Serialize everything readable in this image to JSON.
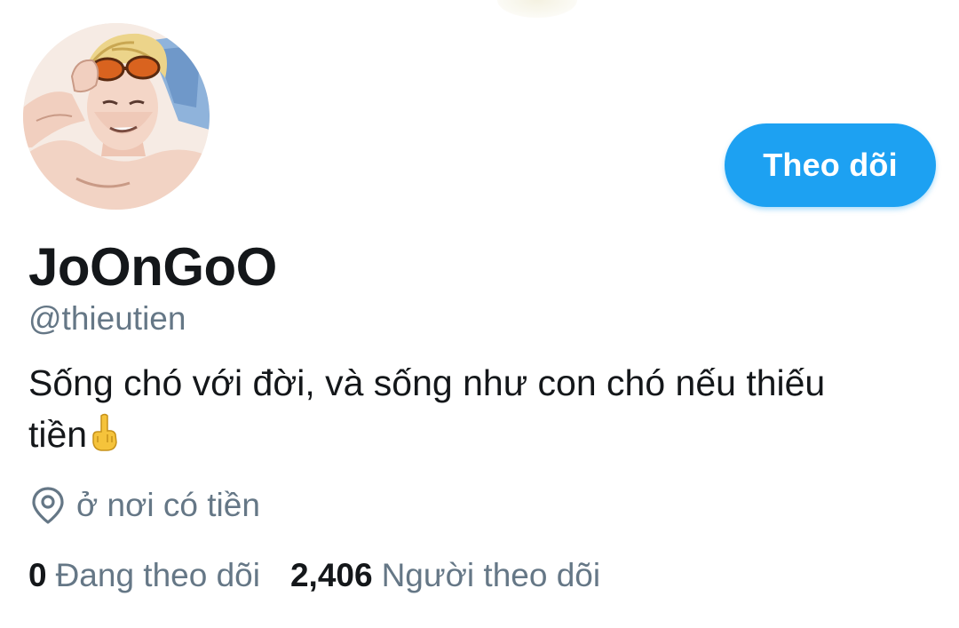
{
  "profile": {
    "display_name": "JoOnGoO",
    "handle": "@thieutien",
    "bio_line1": "Sống chó với đời, và sống như con chó nếu thiếu",
    "bio_line2": "tiền",
    "bio_emoji": "middle-finger-emoji",
    "location": "ở nơi có tiền",
    "following_count": "0",
    "following_label": "Đang theo dõi",
    "followers_count": "2,406",
    "followers_label": "Người theo dõi"
  },
  "actions": {
    "follow_label": "Theo dõi"
  },
  "icons": {
    "location": "location-pin-icon"
  },
  "colors": {
    "accent": "#1da1f2",
    "text_primary": "#14171a",
    "text_secondary": "#657786",
    "background": "#ffffff"
  }
}
